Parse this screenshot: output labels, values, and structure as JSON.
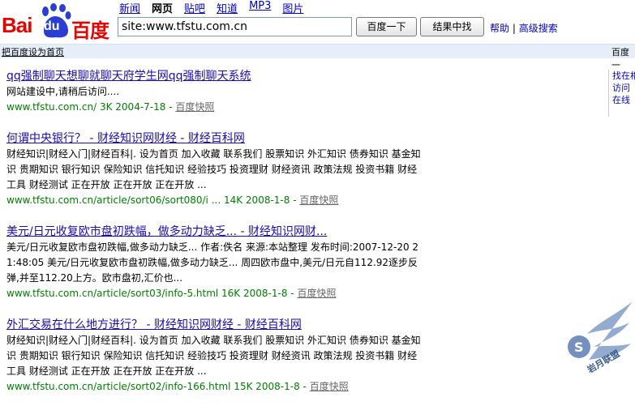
{
  "logo": {
    "part1": "Bai",
    "part2": "du",
    "part3": "百度"
  },
  "nav": {
    "items": [
      {
        "label": "新闻"
      },
      {
        "label": "网页",
        "current": true
      },
      {
        "label": "贴吧"
      },
      {
        "label": "知道"
      },
      {
        "label": "MP3"
      },
      {
        "label": "图片"
      }
    ]
  },
  "search": {
    "value": "site:www.tfstu.com.cn",
    "button_search": "百度一下",
    "button_within": "结果中找",
    "help": "帮助",
    "advanced": "高级搜索"
  },
  "subbar": {
    "set_home": "把百度设为首页",
    "right": "百度一"
  },
  "results": [
    {
      "title": "qq强制聊天想聊就聊天府学生网qq强制聊天系统",
      "desc": "网站建设中,请稍后访问....",
      "url": "www.tfstu.com.cn/ 3K 2004-7-18 -",
      "cache": "百度快照"
    },
    {
      "title": "何谓中央银行？ - 财经知识网财经 - 财经百科网",
      "desc": "财经知识|财经入门|财经百科|. 设为首页 加入收藏 联系我们 股票知识 外汇知识 债券知识 基金知识 贵期知识 银行知识 保险知识 信托知识 经验技巧 投资理财 财经资讯 政策法规 投资书籍 财经工具 财经测试 正在开放 正在开放 正在开放 ...",
      "url": "www.tfstu.com.cn/article/sort06/sort080/i ... 14K 2008-1-8 -",
      "cache": "百度快照"
    },
    {
      "title": "美元/日元收复欧市盘初跌幅，做多动力缺乏... - 财经知识网财...",
      "desc": "美元/日元收复欧市盘初跌幅,做多动力缺乏... 作者:佚名 来源:本站整理 发布时间:2007-12-20 21:48:05 美元/日元收复欧市盘初跌幅,做多动力缺乏... 周四欧市盘中,美元/日元自112.92逐步反弹,并至112.20上方。欧市盘初,汇价也...",
      "url": "www.tfstu.com.cn/article/sort03/info-5.html 16K 2008-1-8 -",
      "cache": "百度快照"
    },
    {
      "title": "外汇交易在什么地方进行？ - 财经知识网财经 - 财经百科网",
      "desc": "财经知识|财经入门|财经百科|. 设为首页 加入收藏 联系我们 股票知识 外汇知识 债券知识 基金知识 贵期知识 银行知识 保险知识 信托知识 经验技巧 投资理财 财经资讯 政策法规 投资书籍 财经工具 财经测试 正在开放 正在开放 正在开放 ...",
      "url": "www.tfstu.com.cn/article/sort02/info-166.html 15K 2008-1-8 -",
      "cache": "百度快照"
    }
  ],
  "rightcol": {
    "l1": "找在相",
    "l2": "访问",
    "l3": "在线"
  },
  "watermark": {
    "text": "岩月联盟"
  },
  "colors": {
    "brand_red": "#e10601",
    "link_blue": "#1a0dab",
    "url_green": "#008000"
  }
}
